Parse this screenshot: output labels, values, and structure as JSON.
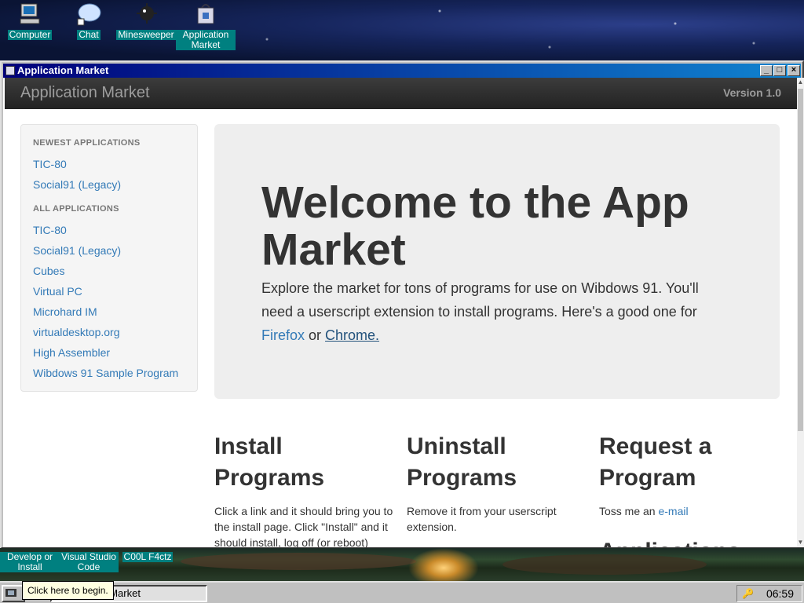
{
  "desktop": {
    "icons": [
      {
        "label": "Computer",
        "icon": "computer-icon"
      },
      {
        "label": "Chat",
        "icon": "chat-icon"
      },
      {
        "label": "Minesweeper",
        "icon": "mine-icon"
      },
      {
        "label": "Application Market",
        "icon": "app-market-icon"
      }
    ],
    "lower_icons": [
      {
        "label": "Develop or Install",
        "icon": "develop-icon"
      },
      {
        "label": "Visual Studio Code",
        "icon": "vscode-icon"
      },
      {
        "label": "C00L F4ctz",
        "icon": "cool-facts-icon"
      }
    ]
  },
  "window": {
    "title": "Application Market",
    "minimize": "_",
    "maximize": "□",
    "close": "×"
  },
  "navbar": {
    "brand": "Application Market",
    "version": "Version 1.0"
  },
  "sidebar": {
    "newest_header": "NEWEST APPLICATIONS",
    "newest": [
      "TIC-80",
      "Social91 (Legacy)"
    ],
    "all_header": "ALL APPLICATIONS",
    "all": [
      "TIC-80",
      "Social91 (Legacy)",
      "Cubes",
      "Virtual PC",
      "Microhard IM",
      "virtualdesktop.org",
      "High Assembler",
      "Wibdows 91 Sample Program"
    ]
  },
  "jumbotron": {
    "heading": "Welcome to the App Market",
    "text_before": "Explore the market for tons of programs for use on Wibdows 91. You'll need a userscript extension to install programs. Here's a good one for ",
    "link_firefox": "Firefox",
    "text_or": " or ",
    "link_chrome": "Chrome."
  },
  "columns": {
    "install": {
      "heading": "Install Programs",
      "text": "Click a link and it should bring you to the install page. Click \"Install\" and it should install, log off (or reboot)"
    },
    "uninstall": {
      "heading": "Uninstall Programs",
      "text": "Remove it from your userscript extension."
    },
    "request": {
      "heading": "Request a Program",
      "text_before": "Toss me an ",
      "link": "e-mail",
      "next_heading": "Applications"
    }
  },
  "taskbar": {
    "tooltip": "Click here to begin.",
    "task_label": "Application Market",
    "clock": "06:59"
  }
}
